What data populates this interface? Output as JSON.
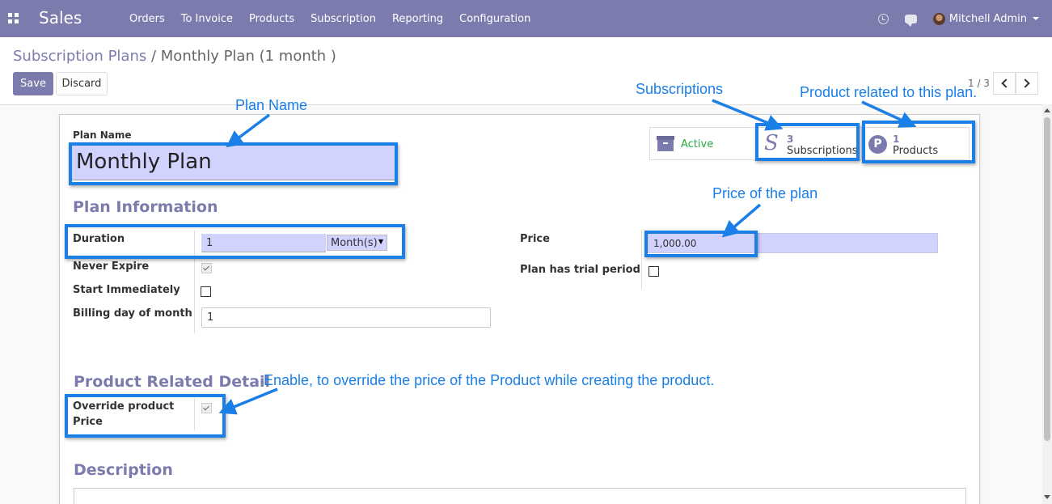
{
  "app": {
    "title": "Sales"
  },
  "menu": {
    "items": [
      "Orders",
      "To Invoice",
      "Products",
      "Subscription",
      "Reporting",
      "Configuration"
    ]
  },
  "user": {
    "name": "Mitchell Admin"
  },
  "breadcrumb": {
    "parent": "Subscription Plans",
    "separator": "/",
    "current": "Monthly Plan (1 month )"
  },
  "toolbar": {
    "save_label": "Save",
    "discard_label": "Discard"
  },
  "pager": {
    "value": "1 / 3"
  },
  "smart_buttons": {
    "active_label": "Active",
    "subscriptions_count": "3",
    "subscriptions_label": "Subscriptions",
    "products_count": "1",
    "products_label": "Products",
    "products_icon_letter": "P",
    "subscriptions_icon_letter": "S"
  },
  "form": {
    "plan_name_label": "Plan Name",
    "plan_name_value": "Monthly Plan",
    "plan_info_title": "Plan Information",
    "duration_label": "Duration",
    "duration_value": "1",
    "duration_unit": "Month(s)",
    "never_expire_label": "Never Expire",
    "never_expire_checked": true,
    "start_immediately_label": "Start Immediately",
    "start_immediately_checked": false,
    "billing_day_label": "Billing day of month",
    "billing_day_value": "1",
    "price_label": "Price",
    "price_value": "1,000.00",
    "trial_label": "Plan has trial period",
    "trial_checked": false,
    "product_detail_title": "Product Related Detail",
    "override_label_line1": "Override product",
    "override_label_line2": "Price",
    "override_checked": true,
    "description_title": "Description"
  },
  "annotations": {
    "plan_name": "Plan Name",
    "subscriptions": "Subscriptions",
    "products": "Product related to this plan.",
    "price": "Price of the plan",
    "override": "Enable, to override the price of the Product while creating the product.",
    "color": "#1a7fe6"
  },
  "colors": {
    "brand": "#7c7bad",
    "active": "#28a745",
    "input_highlight": "#d2d2ff"
  }
}
